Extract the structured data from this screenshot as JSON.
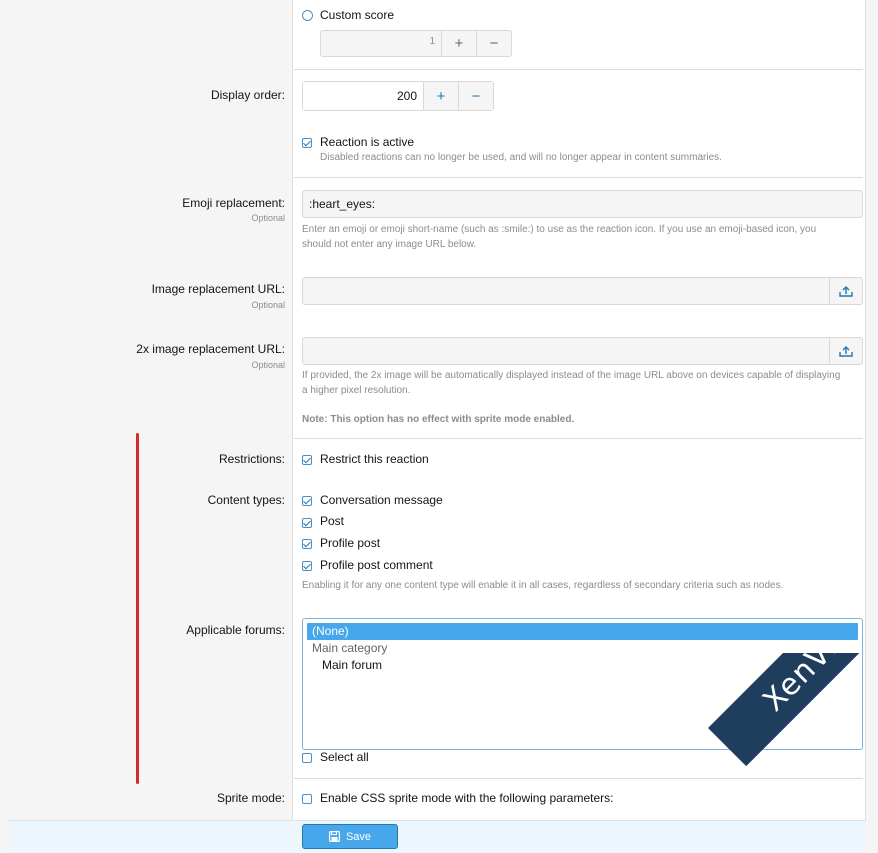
{
  "custom_score": {
    "label": "Custom score",
    "value": "1",
    "plus": "+",
    "minus": "−"
  },
  "display_order": {
    "label": "Display order:",
    "value": "200",
    "plus": "+",
    "minus": "−"
  },
  "active": {
    "label": "Reaction is active",
    "hint": "Disabled reactions can no longer be used, and will no longer appear in content summaries."
  },
  "emoji": {
    "label": "Emoji replacement:",
    "optional": "Optional",
    "value": ":heart_eyes:",
    "hint1": "Enter an emoji or emoji short-name (such as :smile:) to use as the reaction icon. If you use an emoji-based icon, you",
    "hint2": "should not enter any image URL below."
  },
  "image_url": {
    "label": "Image replacement URL:",
    "optional": "Optional",
    "value": ""
  },
  "image_url_2x": {
    "label": "2x image replacement URL:",
    "optional": "Optional",
    "value": "",
    "hint1": "If provided, the 2x image will be automatically displayed instead of the image URL above on devices capable of displaying",
    "hint2": "a higher pixel resolution.",
    "note": "Note: This option has no effect with sprite mode enabled."
  },
  "restrictions": {
    "label": "Restrictions:",
    "option": "Restrict this reaction"
  },
  "content_types": {
    "label": "Content types:",
    "items": [
      "Conversation message",
      "Post",
      "Profile post",
      "Profile post comment"
    ],
    "hint": "Enabling it for any one content type will enable it in all cases, regardless of secondary criteria such as nodes."
  },
  "forums": {
    "label": "Applicable forums:",
    "options": [
      "(None)",
      "Main category",
      "Main forum"
    ],
    "select_all": "Select all"
  },
  "sprite": {
    "label": "Sprite mode:",
    "option": "Enable CSS sprite mode with the following parameters:"
  },
  "footer": {
    "save_label": "Save"
  },
  "watermark": {
    "text": "XenVn.Com"
  },
  "colors": {
    "accent": "#47a7eb",
    "accent_dark": "#2577b1",
    "annotation": "#d42a2a"
  }
}
